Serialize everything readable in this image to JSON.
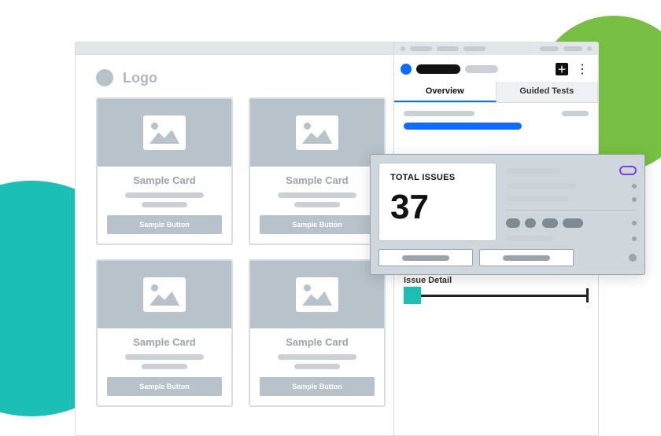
{
  "brand": {
    "logo_text": "Logo"
  },
  "cards": [
    {
      "title": "Sample Card",
      "button": "Sample Button"
    },
    {
      "title": "Sample Card",
      "button": "Sample Button"
    },
    {
      "title": "Sample Card",
      "button": "Sample Button"
    },
    {
      "title": "Sample Card",
      "button": "Sample Button"
    }
  ],
  "panel": {
    "tabs": {
      "overview": "Overview",
      "guided": "Guided Tests"
    },
    "issue_detail_label": "Issue Detail"
  },
  "summary": {
    "total_label": "TOTAL ISSUES",
    "total_value": "37"
  }
}
